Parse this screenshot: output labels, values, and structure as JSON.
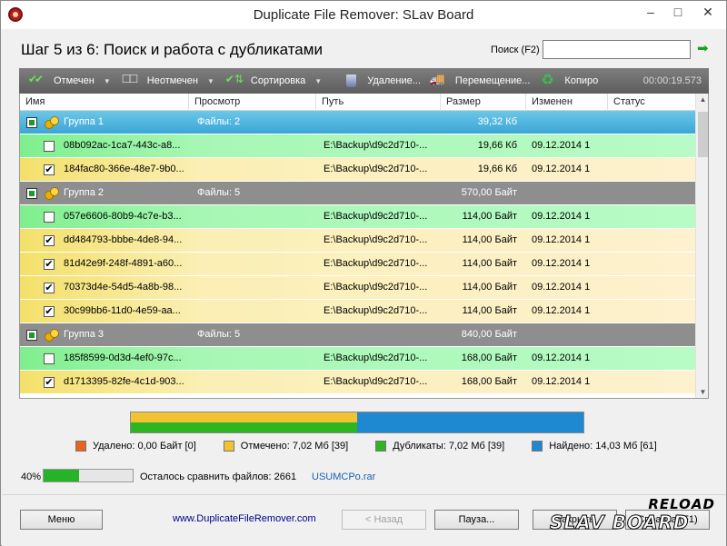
{
  "window": {
    "title": "Duplicate File Remover: SLav Board"
  },
  "window_controls": {
    "minimize": "–",
    "maximize": "□",
    "close": "✕"
  },
  "header": {
    "step_title": "Шаг 5 из 6: Поиск и работа с дубликатами",
    "search_label": "Поиск (F2)",
    "search_value": "",
    "search_placeholder": ""
  },
  "toolbar": {
    "items": [
      {
        "label": "Отмечен",
        "icon": "checked-icon",
        "dropdown": true
      },
      {
        "label": "Неотмечен",
        "icon": "unchecked-icon",
        "dropdown": true
      },
      {
        "label": "Сортировка",
        "icon": "sort-icon",
        "dropdown": true
      },
      {
        "label": "Удаление...",
        "icon": "trash-icon",
        "dropdown": false
      },
      {
        "label": "Перемещение...",
        "icon": "move-icon",
        "dropdown": false
      },
      {
        "label": "Копиро",
        "icon": "copy-icon",
        "dropdown": false
      }
    ],
    "timer": "00:00:19.573"
  },
  "grid": {
    "columns": [
      "Имя",
      "Просмотр",
      "Путь",
      "Размер",
      "Изменен",
      "Статус"
    ],
    "rows": [
      {
        "type": "group",
        "active": true,
        "name": "Группа 1",
        "view": "Файлы: 2",
        "path": "",
        "size": "39,32 Кб",
        "modified": ""
      },
      {
        "type": "file",
        "checked": false,
        "name": "08b092ac-1ca7-443c-a8...",
        "view": "",
        "path": "E:\\Backup\\d9c2d710-...",
        "size": "19,66 Кб",
        "modified": "09.12.2014 1"
      },
      {
        "type": "file",
        "checked": true,
        "name": "184fac80-366e-48e7-9b0...",
        "view": "",
        "path": "E:\\Backup\\d9c2d710-...",
        "size": "19,66 Кб",
        "modified": "09.12.2014 1"
      },
      {
        "type": "group",
        "active": false,
        "name": "Группа 2",
        "view": "Файлы: 5",
        "path": "",
        "size": "570,00 Байт",
        "modified": ""
      },
      {
        "type": "file",
        "checked": false,
        "name": "057e6606-80b9-4c7e-b3...",
        "view": "",
        "path": "E:\\Backup\\d9c2d710-...",
        "size": "114,00 Байт",
        "modified": "09.12.2014 1"
      },
      {
        "type": "file",
        "checked": true,
        "name": "dd484793-bbbe-4de8-94...",
        "view": "",
        "path": "E:\\Backup\\d9c2d710-...",
        "size": "114,00 Байт",
        "modified": "09.12.2014 1"
      },
      {
        "type": "file",
        "checked": true,
        "name": "81d42e9f-248f-4891-a60...",
        "view": "",
        "path": "E:\\Backup\\d9c2d710-...",
        "size": "114,00 Байт",
        "modified": "09.12.2014 1"
      },
      {
        "type": "file",
        "checked": true,
        "name": "70373d4e-54d5-4a8b-98...",
        "view": "",
        "path": "E:\\Backup\\d9c2d710-...",
        "size": "114,00 Байт",
        "modified": "09.12.2014 1"
      },
      {
        "type": "file",
        "checked": true,
        "name": "30c99bb6-11d0-4e59-aa...",
        "view": "",
        "path": "E:\\Backup\\d9c2d710-...",
        "size": "114,00 Байт",
        "modified": "09.12.2014 1"
      },
      {
        "type": "group",
        "active": false,
        "name": "Группа 3",
        "view": "Файлы: 5",
        "path": "",
        "size": "840,00 Байт",
        "modified": ""
      },
      {
        "type": "file",
        "checked": false,
        "name": "185f8599-0d3d-4ef0-97c...",
        "view": "",
        "path": "E:\\Backup\\d9c2d710-...",
        "size": "168,00 Байт",
        "modified": "09.12.2014 1"
      },
      {
        "type": "file",
        "checked": true,
        "name": "d1713395-82fe-4c1d-903...",
        "view": "",
        "path": "E:\\Backup\\d9c2d710-...",
        "size": "168,00 Байт",
        "modified": "09.12.2014 1"
      }
    ]
  },
  "summary": {
    "bar": {
      "marked_fraction": 0.5,
      "duplicates_fraction": 0.5,
      "found_fraction": 1.0
    },
    "legend": [
      {
        "label": "Удалено: 0,00 Байт [0]",
        "color": "#e8641c"
      },
      {
        "label": "Отмечено: 7,02 Мб [39]",
        "color": "#f1c232"
      },
      {
        "label": "Дубликаты: 7,02 Мб [39]",
        "color": "#2fb521"
      },
      {
        "label": "Найдено: 14,03 Мб [61]",
        "color": "#1e88d0"
      }
    ],
    "progress_percent_label": "40%",
    "progress_percent": 40,
    "remaining_label": "Осталось сравнить файлов: 2661",
    "current_file": "USUMCPo.rar"
  },
  "footer": {
    "menu_label": "Меню",
    "website": "www.DuplicateFileRemover.com",
    "back_label": "< Назад",
    "pause_label": "Пауза...",
    "close_label": "Закрыть",
    "help_label": "Справка (F1)"
  },
  "watermark": {
    "top": "RELOAD",
    "bottom": "SLAV BOARD"
  }
}
